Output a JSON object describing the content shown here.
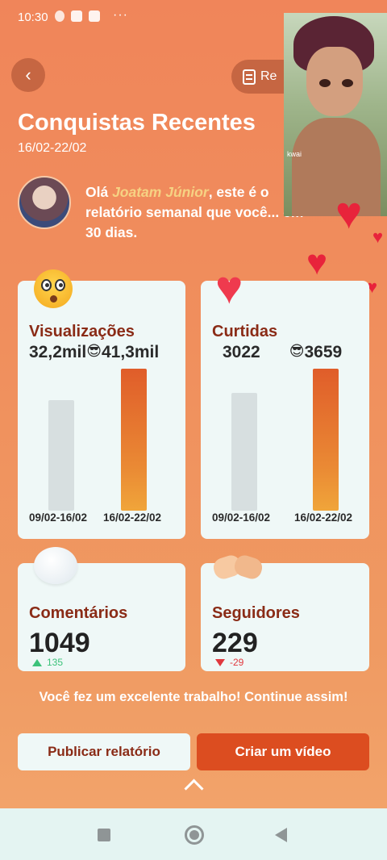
{
  "status_bar": {
    "time": "10:30",
    "more": "···"
  },
  "header": {
    "back_icon": "chevron-left-icon",
    "report_button_label": "Re"
  },
  "page": {
    "title": "Conquistas Recentes",
    "date_range": "16/02-22/02"
  },
  "greeting": {
    "prefix": "Olá ",
    "user": "Joatam Júnior",
    "suffix": ", este é o relatório semanal que você... em 30 dias."
  },
  "overlay": {
    "label": "kwai"
  },
  "cards": {
    "views": {
      "title": "Visualizações",
      "previous": "32,2mil",
      "current_icon": "😎",
      "current": "41,3mil",
      "previous_fraction": 0.78,
      "current_fraction": 1.0,
      "label_prev": "09/02-16/02",
      "label_cur": "16/02-22/02"
    },
    "likes": {
      "title": "Curtidas",
      "previous": "3022",
      "current_icon": "😎",
      "current": "3659",
      "previous_fraction": 0.83,
      "current_fraction": 1.0,
      "label_prev": "09/02-16/02",
      "label_cur": "16/02-22/02"
    },
    "comments": {
      "title": "Comentários",
      "value": "1049",
      "delta": "135",
      "trend": "up"
    },
    "followers": {
      "title": "Seguidores",
      "value": "229",
      "delta": "-29",
      "trend": "down"
    }
  },
  "tagline": "Você fez um excelente trabalho! Continue assim!",
  "buttons": {
    "publish": "Publicar relatório",
    "create": "Criar um vídeo"
  },
  "colors": {
    "accent": "#dc4d20",
    "card_title": "#8a2b16",
    "delta_up": "#3cc27a",
    "delta_down": "#e0383e"
  }
}
